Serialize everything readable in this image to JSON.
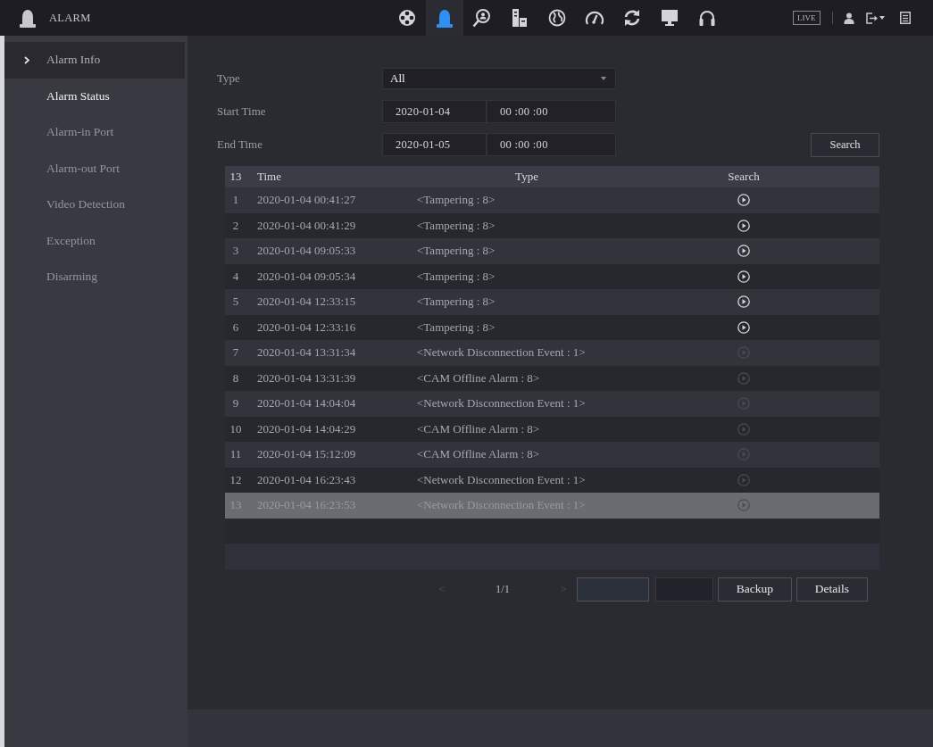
{
  "header": {
    "title": "ALARM"
  },
  "nav": [
    {
      "selected": false
    },
    {
      "selected": true
    },
    {
      "selected": false
    },
    {
      "selected": false
    },
    {
      "selected": false
    },
    {
      "selected": false
    },
    {
      "selected": false
    },
    {
      "selected": false
    },
    {
      "selected": false
    }
  ],
  "top_right": {
    "live": "LIVE"
  },
  "sidebar": {
    "items": [
      {
        "label": "Alarm Info",
        "selected": true,
        "hovered": false
      },
      {
        "label": "Alarm Status",
        "selected": false,
        "hovered": true
      },
      {
        "label": "Alarm-in Port",
        "selected": false,
        "hovered": false
      },
      {
        "label": "Alarm-out Port",
        "selected": false,
        "hovered": false
      },
      {
        "label": "Video Detection",
        "selected": false,
        "hovered": false
      },
      {
        "label": "Exception",
        "selected": false,
        "hovered": false
      },
      {
        "label": "Disarming",
        "selected": false,
        "hovered": false
      }
    ]
  },
  "form": {
    "type": {
      "label": "Type",
      "value": "All"
    },
    "start_time": {
      "label": "Start Time",
      "date": "2020-01-04",
      "time": "00 :00 :00"
    },
    "end_time": {
      "label": "End Time",
      "date": "2020-01-05",
      "time": "00 :00 :00"
    },
    "search_button": "Search"
  },
  "table": {
    "columns": [
      "13",
      "Time",
      "Type",
      "Search"
    ],
    "rows": [
      {
        "index": "1",
        "time": "2020-01-04 00:41:27",
        "type": "<Tampering : 8>",
        "playable": true,
        "selected": false
      },
      {
        "index": "2",
        "time": "2020-01-04 00:41:29",
        "type": "<Tampering : 8>",
        "playable": true,
        "selected": false
      },
      {
        "index": "3",
        "time": "2020-01-04 09:05:33",
        "type": "<Tampering : 8>",
        "playable": true,
        "selected": false
      },
      {
        "index": "4",
        "time": "2020-01-04 09:05:34",
        "type": "<Tampering : 8>",
        "playable": true,
        "selected": false
      },
      {
        "index": "5",
        "time": "2020-01-04 12:33:15",
        "type": "<Tampering : 8>",
        "playable": true,
        "selected": false
      },
      {
        "index": "6",
        "time": "2020-01-04 12:33:16",
        "type": "<Tampering : 8>",
        "playable": true,
        "selected": false
      },
      {
        "index": "7",
        "time": "2020-01-04 13:31:34",
        "type": "<Network Disconnection Event : 1>",
        "playable": false,
        "selected": false
      },
      {
        "index": "8",
        "time": "2020-01-04 13:31:39",
        "type": "<CAM Offline Alarm : 8>",
        "playable": false,
        "selected": false
      },
      {
        "index": "9",
        "time": "2020-01-04 14:04:04",
        "type": "<Network Disconnection Event : 1>",
        "playable": false,
        "selected": false
      },
      {
        "index": "10",
        "time": "2020-01-04 14:04:29",
        "type": "<CAM Offline Alarm : 8>",
        "playable": false,
        "selected": false
      },
      {
        "index": "11",
        "time": "2020-01-04 15:12:09",
        "type": "<CAM Offline Alarm : 8>",
        "playable": false,
        "selected": false
      },
      {
        "index": "12",
        "time": "2020-01-04 16:23:43",
        "type": "<Network Disconnection Event : 1>",
        "playable": false,
        "selected": false
      },
      {
        "index": "13",
        "time": "2020-01-04 16:23:53",
        "type": "<Network Disconnection Event : 1>",
        "playable": false,
        "selected": true
      }
    ]
  },
  "pager": {
    "prev": {
      "label": "<",
      "disabled": true
    },
    "page": "1/1",
    "next": {
      "label": ">",
      "disabled": true
    }
  },
  "actions": [
    {
      "kind": "field"
    },
    {
      "kind": "button",
      "disabled": true
    },
    {
      "kind": "button",
      "label": "Backup",
      "disabled": false
    },
    {
      "kind": "button",
      "label": "Details",
      "disabled": false
    }
  ]
}
